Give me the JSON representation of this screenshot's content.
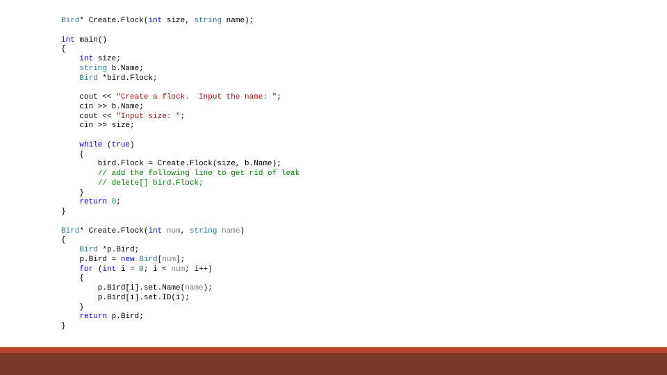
{
  "code": {
    "lines": [
      {
        "kind": "code",
        "spans": [
          {
            "c": "tok-type",
            "t": "Bird"
          },
          {
            "c": "tok-ident",
            "t": "* Create.Flock("
          },
          {
            "c": "tok-kw",
            "t": "int"
          },
          {
            "c": "tok-ident",
            "t": " size, "
          },
          {
            "c": "tok-type",
            "t": "string"
          },
          {
            "c": "tok-ident",
            "t": " name);"
          }
        ]
      },
      {
        "kind": "blank"
      },
      {
        "kind": "code",
        "spans": [
          {
            "c": "tok-kw",
            "t": "int"
          },
          {
            "c": "tok-ident",
            "t": " main()"
          }
        ]
      },
      {
        "kind": "code",
        "spans": [
          {
            "c": "tok-ident",
            "t": "{"
          }
        ]
      },
      {
        "kind": "code",
        "spans": [
          {
            "c": "tok-ident",
            "t": "    "
          },
          {
            "c": "tok-kw",
            "t": "int"
          },
          {
            "c": "tok-ident",
            "t": " size;"
          }
        ]
      },
      {
        "kind": "code",
        "spans": [
          {
            "c": "tok-ident",
            "t": "    "
          },
          {
            "c": "tok-type",
            "t": "string"
          },
          {
            "c": "tok-ident",
            "t": " b.Name;"
          }
        ]
      },
      {
        "kind": "code",
        "spans": [
          {
            "c": "tok-ident",
            "t": "    "
          },
          {
            "c": "tok-type",
            "t": "Bird"
          },
          {
            "c": "tok-ident",
            "t": " *bird.Flock;"
          }
        ]
      },
      {
        "kind": "blank"
      },
      {
        "kind": "code",
        "spans": [
          {
            "c": "tok-ident",
            "t": "    cout << "
          },
          {
            "c": "tok-str",
            "t": "\"Create a flock.  Input the name: \""
          },
          {
            "c": "tok-ident",
            "t": ";"
          }
        ]
      },
      {
        "kind": "code",
        "spans": [
          {
            "c": "tok-ident",
            "t": "    cin >> b.Name;"
          }
        ]
      },
      {
        "kind": "code",
        "spans": [
          {
            "c": "tok-ident",
            "t": "    cout << "
          },
          {
            "c": "tok-str",
            "t": "\"Input size: \""
          },
          {
            "c": "tok-ident",
            "t": ";"
          }
        ]
      },
      {
        "kind": "code",
        "spans": [
          {
            "c": "tok-ident",
            "t": "    cin >> size;"
          }
        ]
      },
      {
        "kind": "blank"
      },
      {
        "kind": "code",
        "spans": [
          {
            "c": "tok-ident",
            "t": "    "
          },
          {
            "c": "tok-kw",
            "t": "while"
          },
          {
            "c": "tok-ident",
            "t": " ("
          },
          {
            "c": "tok-kw",
            "t": "true"
          },
          {
            "c": "tok-ident",
            "t": ")"
          }
        ]
      },
      {
        "kind": "code",
        "spans": [
          {
            "c": "tok-ident",
            "t": "    {"
          }
        ]
      },
      {
        "kind": "code",
        "spans": [
          {
            "c": "tok-ident",
            "t": "        bird.Flock = Create.Flock(size, b.Name);"
          }
        ]
      },
      {
        "kind": "code",
        "spans": [
          {
            "c": "tok-ident",
            "t": "        "
          },
          {
            "c": "tok-cmt",
            "t": "// add the following line to get rid of leak"
          }
        ]
      },
      {
        "kind": "code",
        "spans": [
          {
            "c": "tok-ident",
            "t": "        "
          },
          {
            "c": "tok-cmt",
            "t": "// delete[] bird.Flock;"
          }
        ]
      },
      {
        "kind": "code",
        "spans": [
          {
            "c": "tok-ident",
            "t": "    }"
          }
        ]
      },
      {
        "kind": "code",
        "spans": [
          {
            "c": "tok-ident",
            "t": "    "
          },
          {
            "c": "tok-kw",
            "t": "return"
          },
          {
            "c": "tok-ident",
            "t": " "
          },
          {
            "c": "tok-num",
            "t": "0"
          },
          {
            "c": "tok-ident",
            "t": ";"
          }
        ]
      },
      {
        "kind": "code",
        "spans": [
          {
            "c": "tok-ident",
            "t": "}"
          }
        ]
      },
      {
        "kind": "blank"
      },
      {
        "kind": "code",
        "spans": [
          {
            "c": "tok-type",
            "t": "Bird"
          },
          {
            "c": "tok-ident",
            "t": "* Create.Flock("
          },
          {
            "c": "tok-kw",
            "t": "int"
          },
          {
            "c": "tok-ident",
            "t": " "
          },
          {
            "c": "tok-param",
            "t": "num"
          },
          {
            "c": "tok-ident",
            "t": ", "
          },
          {
            "c": "tok-type",
            "t": "string"
          },
          {
            "c": "tok-ident",
            "t": " "
          },
          {
            "c": "tok-param",
            "t": "name"
          },
          {
            "c": "tok-ident",
            "t": ")"
          }
        ]
      },
      {
        "kind": "code",
        "spans": [
          {
            "c": "tok-ident",
            "t": "{"
          }
        ]
      },
      {
        "kind": "code",
        "spans": [
          {
            "c": "tok-ident",
            "t": "    "
          },
          {
            "c": "tok-type",
            "t": "Bird"
          },
          {
            "c": "tok-ident",
            "t": " *p.Bird;"
          }
        ]
      },
      {
        "kind": "code",
        "spans": [
          {
            "c": "tok-ident",
            "t": "    p.Bird = "
          },
          {
            "c": "tok-kw",
            "t": "new"
          },
          {
            "c": "tok-ident",
            "t": " "
          },
          {
            "c": "tok-type",
            "t": "Bird"
          },
          {
            "c": "tok-ident",
            "t": "["
          },
          {
            "c": "tok-param",
            "t": "num"
          },
          {
            "c": "tok-ident",
            "t": "];"
          }
        ]
      },
      {
        "kind": "code",
        "spans": [
          {
            "c": "tok-ident",
            "t": "    "
          },
          {
            "c": "tok-kw",
            "t": "for"
          },
          {
            "c": "tok-ident",
            "t": " ("
          },
          {
            "c": "tok-kw",
            "t": "int"
          },
          {
            "c": "tok-ident",
            "t": " i = "
          },
          {
            "c": "tok-num",
            "t": "0"
          },
          {
            "c": "tok-ident",
            "t": "; i < "
          },
          {
            "c": "tok-param",
            "t": "num"
          },
          {
            "c": "tok-ident",
            "t": "; i++)"
          }
        ]
      },
      {
        "kind": "code",
        "spans": [
          {
            "c": "tok-ident",
            "t": "    {"
          }
        ]
      },
      {
        "kind": "code",
        "spans": [
          {
            "c": "tok-ident",
            "t": "        p.Bird[i].set.Name("
          },
          {
            "c": "tok-param",
            "t": "name"
          },
          {
            "c": "tok-ident",
            "t": ");"
          }
        ]
      },
      {
        "kind": "code",
        "spans": [
          {
            "c": "tok-ident",
            "t": "        p.Bird[i].set.ID(i);"
          }
        ]
      },
      {
        "kind": "code",
        "spans": [
          {
            "c": "tok-ident",
            "t": "    }"
          }
        ]
      },
      {
        "kind": "code",
        "spans": [
          {
            "c": "tok-ident",
            "t": "    "
          },
          {
            "c": "tok-kw",
            "t": "return"
          },
          {
            "c": "tok-ident",
            "t": " p.Bird;"
          }
        ]
      },
      {
        "kind": "code",
        "spans": [
          {
            "c": "tok-ident",
            "t": "}"
          }
        ]
      }
    ]
  },
  "bands": {
    "orange": "#b8452c",
    "brown": "#7a3a2a"
  }
}
